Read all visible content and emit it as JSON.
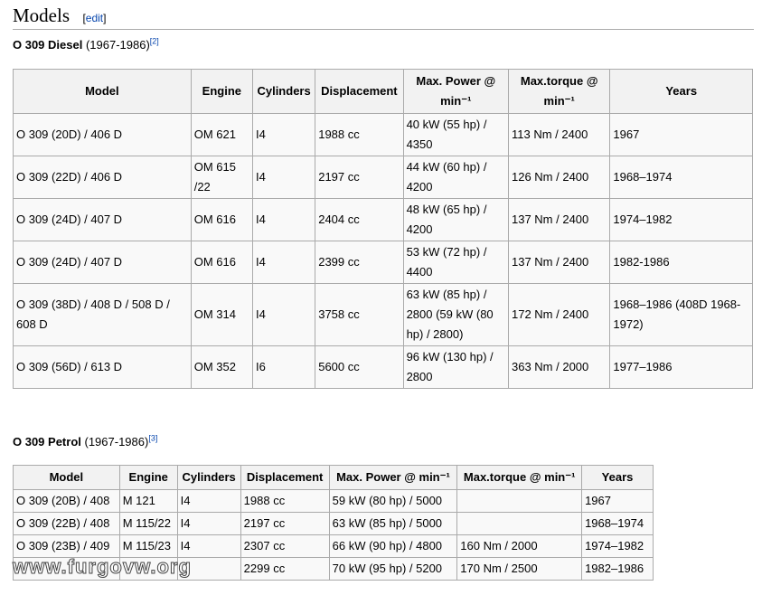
{
  "heading": {
    "title": "Models",
    "edit": "edit",
    "edit_open": "[",
    "edit_close": "]"
  },
  "diesel": {
    "name": "O 309 Diesel",
    "years": " (1967-1986)",
    "ref": "[2]",
    "headers": [
      "Model",
      "Engine",
      "Cylinders",
      "Displacement",
      "Max. Power @ min⁻¹",
      "Max.torque @ min⁻¹",
      "Years"
    ],
    "rows": [
      [
        "O 309 (20D) / 406 D",
        "OM 621",
        "I4",
        "1988 cc",
        "40 kW (55 hp) / 4350",
        "113 Nm / 2400",
        "1967"
      ],
      [
        "O 309 (22D) / 406 D",
        "OM 615 /22",
        "I4",
        "2197 cc",
        "44 kW (60 hp) / 4200",
        "126 Nm / 2400",
        "1968–1974"
      ],
      [
        "O 309 (24D) / 407 D",
        "OM 616",
        "I4",
        "2404 cc",
        "48 kW (65 hp) / 4200",
        "137 Nm / 2400",
        "1974–1982"
      ],
      [
        "O 309 (24D) / 407 D",
        "OM 616",
        "I4",
        "2399 cc",
        "53 kW (72 hp) / 4400",
        "137 Nm / 2400",
        "1982-1986"
      ],
      [
        "O 309 (38D) / 408 D / 508 D / 608 D",
        "OM 314",
        "I4",
        "3758 cc",
        "63 kW (85 hp) / 2800 (59 kW (80 hp) / 2800)",
        "172 Nm / 2400",
        "1968–1986 (408D 1968-1972)"
      ],
      [
        "O 309 (56D) / 613 D",
        "OM 352",
        "I6",
        "5600 cc",
        "96 kW (130 hp) / 2800",
        "363 Nm / 2000",
        "1977–1986"
      ]
    ]
  },
  "petrol": {
    "name": "O 309 Petrol",
    "years": " (1967-1986)",
    "ref": "[3]",
    "headers": [
      "Model",
      "Engine",
      "Cylinders",
      "Displacement",
      "Max. Power @ min⁻¹",
      "Max.torque @ min⁻¹",
      "Years"
    ],
    "rows": [
      [
        "O 309 (20B) / 408",
        "M 121",
        "I4",
        "1988 cc",
        "59 kW (80 hp) / 5000",
        "",
        "1967"
      ],
      [
        "O 309 (22B) / 408",
        "M 115/22",
        "I4",
        "2197 cc",
        "63 kW (85 hp) / 5000",
        "",
        "1968–1974"
      ],
      [
        "O 309 (23B) / 409",
        "M 115/23",
        "I4",
        "2307 cc",
        "66 kW (90 hp) / 4800",
        "160 Nm / 2000",
        "1974–1982"
      ],
      [
        "",
        "",
        "",
        "2299 cc",
        "70 kW (95 hp) / 5200",
        "170 Nm / 2500",
        "1982–1986"
      ]
    ]
  },
  "watermark": "www.furgovw.org"
}
